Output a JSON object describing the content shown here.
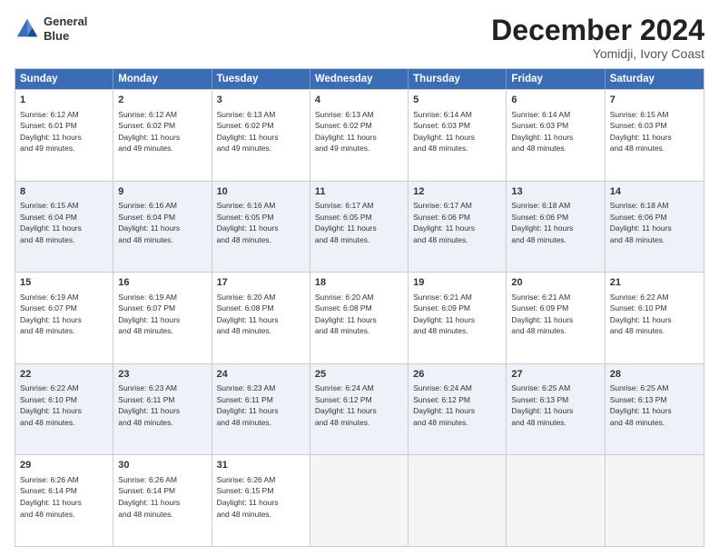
{
  "logo": {
    "line1": "General",
    "line2": "Blue"
  },
  "title": "December 2024",
  "subtitle": "Yomidji, Ivory Coast",
  "days": [
    "Sunday",
    "Monday",
    "Tuesday",
    "Wednesday",
    "Thursday",
    "Friday",
    "Saturday"
  ],
  "rows": [
    [
      {
        "day": "1",
        "text": "Sunrise: 6:12 AM\nSunset: 6:01 PM\nDaylight: 11 hours\nand 49 minutes."
      },
      {
        "day": "2",
        "text": "Sunrise: 6:12 AM\nSunset: 6:02 PM\nDaylight: 11 hours\nand 49 minutes."
      },
      {
        "day": "3",
        "text": "Sunrise: 6:13 AM\nSunset: 6:02 PM\nDaylight: 11 hours\nand 49 minutes."
      },
      {
        "day": "4",
        "text": "Sunrise: 6:13 AM\nSunset: 6:02 PM\nDaylight: 11 hours\nand 49 minutes."
      },
      {
        "day": "5",
        "text": "Sunrise: 6:14 AM\nSunset: 6:03 PM\nDaylight: 11 hours\nand 48 minutes."
      },
      {
        "day": "6",
        "text": "Sunrise: 6:14 AM\nSunset: 6:03 PM\nDaylight: 11 hours\nand 48 minutes."
      },
      {
        "day": "7",
        "text": "Sunrise: 6:15 AM\nSunset: 6:03 PM\nDaylight: 11 hours\nand 48 minutes."
      }
    ],
    [
      {
        "day": "8",
        "text": "Sunrise: 6:15 AM\nSunset: 6:04 PM\nDaylight: 11 hours\nand 48 minutes."
      },
      {
        "day": "9",
        "text": "Sunrise: 6:16 AM\nSunset: 6:04 PM\nDaylight: 11 hours\nand 48 minutes."
      },
      {
        "day": "10",
        "text": "Sunrise: 6:16 AM\nSunset: 6:05 PM\nDaylight: 11 hours\nand 48 minutes."
      },
      {
        "day": "11",
        "text": "Sunrise: 6:17 AM\nSunset: 6:05 PM\nDaylight: 11 hours\nand 48 minutes."
      },
      {
        "day": "12",
        "text": "Sunrise: 6:17 AM\nSunset: 6:06 PM\nDaylight: 11 hours\nand 48 minutes."
      },
      {
        "day": "13",
        "text": "Sunrise: 6:18 AM\nSunset: 6:06 PM\nDaylight: 11 hours\nand 48 minutes."
      },
      {
        "day": "14",
        "text": "Sunrise: 6:18 AM\nSunset: 6:06 PM\nDaylight: 11 hours\nand 48 minutes."
      }
    ],
    [
      {
        "day": "15",
        "text": "Sunrise: 6:19 AM\nSunset: 6:07 PM\nDaylight: 11 hours\nand 48 minutes."
      },
      {
        "day": "16",
        "text": "Sunrise: 6:19 AM\nSunset: 6:07 PM\nDaylight: 11 hours\nand 48 minutes."
      },
      {
        "day": "17",
        "text": "Sunrise: 6:20 AM\nSunset: 6:08 PM\nDaylight: 11 hours\nand 48 minutes."
      },
      {
        "day": "18",
        "text": "Sunrise: 6:20 AM\nSunset: 6:08 PM\nDaylight: 11 hours\nand 48 minutes."
      },
      {
        "day": "19",
        "text": "Sunrise: 6:21 AM\nSunset: 6:09 PM\nDaylight: 11 hours\nand 48 minutes."
      },
      {
        "day": "20",
        "text": "Sunrise: 6:21 AM\nSunset: 6:09 PM\nDaylight: 11 hours\nand 48 minutes."
      },
      {
        "day": "21",
        "text": "Sunrise: 6:22 AM\nSunset: 6:10 PM\nDaylight: 11 hours\nand 48 minutes."
      }
    ],
    [
      {
        "day": "22",
        "text": "Sunrise: 6:22 AM\nSunset: 6:10 PM\nDaylight: 11 hours\nand 48 minutes."
      },
      {
        "day": "23",
        "text": "Sunrise: 6:23 AM\nSunset: 6:11 PM\nDaylight: 11 hours\nand 48 minutes."
      },
      {
        "day": "24",
        "text": "Sunrise: 6:23 AM\nSunset: 6:11 PM\nDaylight: 11 hours\nand 48 minutes."
      },
      {
        "day": "25",
        "text": "Sunrise: 6:24 AM\nSunset: 6:12 PM\nDaylight: 11 hours\nand 48 minutes."
      },
      {
        "day": "26",
        "text": "Sunrise: 6:24 AM\nSunset: 6:12 PM\nDaylight: 11 hours\nand 48 minutes."
      },
      {
        "day": "27",
        "text": "Sunrise: 6:25 AM\nSunset: 6:13 PM\nDaylight: 11 hours\nand 48 minutes."
      },
      {
        "day": "28",
        "text": "Sunrise: 6:25 AM\nSunset: 6:13 PM\nDaylight: 11 hours\nand 48 minutes."
      }
    ],
    [
      {
        "day": "29",
        "text": "Sunrise: 6:26 AM\nSunset: 6:14 PM\nDaylight: 11 hours\nand 48 minutes."
      },
      {
        "day": "30",
        "text": "Sunrise: 6:26 AM\nSunset: 6:14 PM\nDaylight: 11 hours\nand 48 minutes."
      },
      {
        "day": "31",
        "text": "Sunrise: 6:26 AM\nSunset: 6:15 PM\nDaylight: 11 hours\nand 48 minutes."
      },
      {
        "day": "",
        "text": ""
      },
      {
        "day": "",
        "text": ""
      },
      {
        "day": "",
        "text": ""
      },
      {
        "day": "",
        "text": ""
      }
    ]
  ]
}
